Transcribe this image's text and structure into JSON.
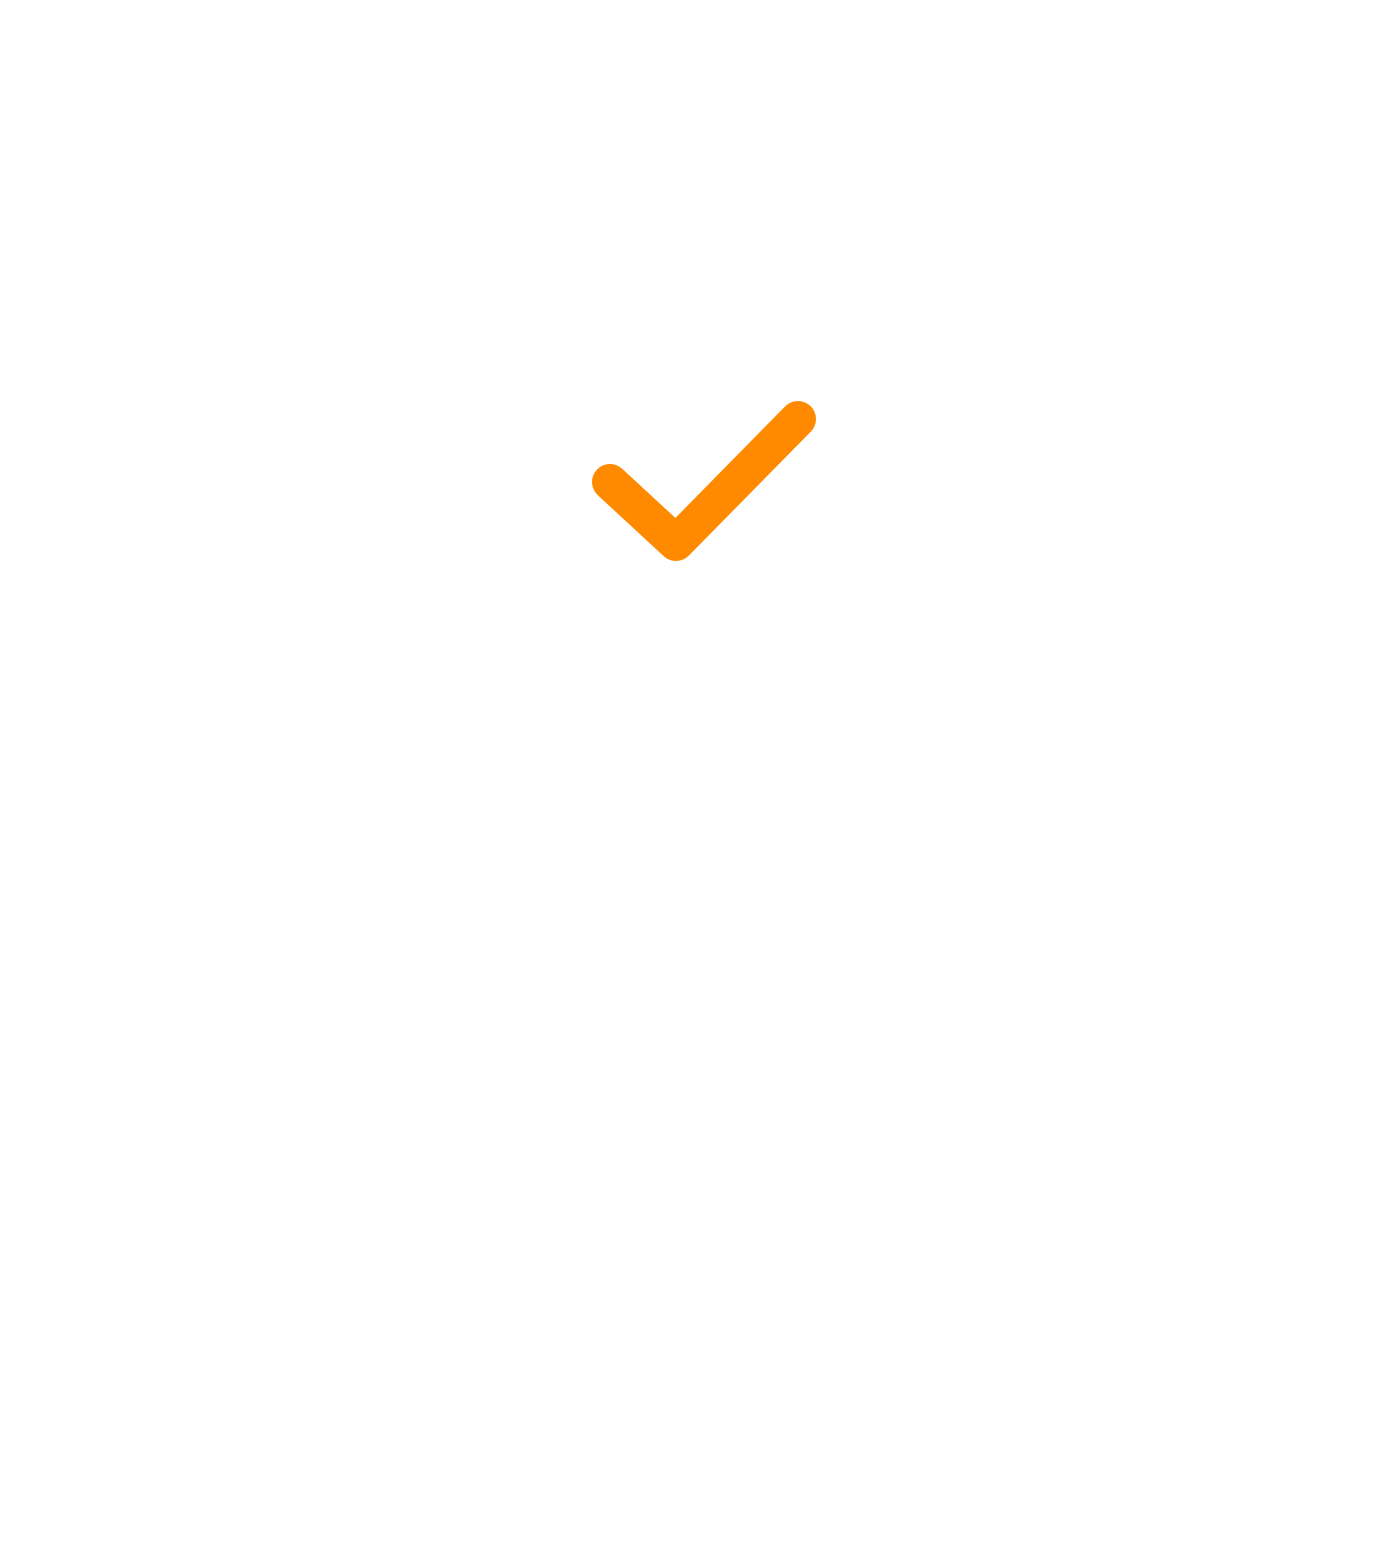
{
  "icon": {
    "name": "check-icon",
    "color": "#FF8A00"
  },
  "background_color": "#FFFFFF"
}
